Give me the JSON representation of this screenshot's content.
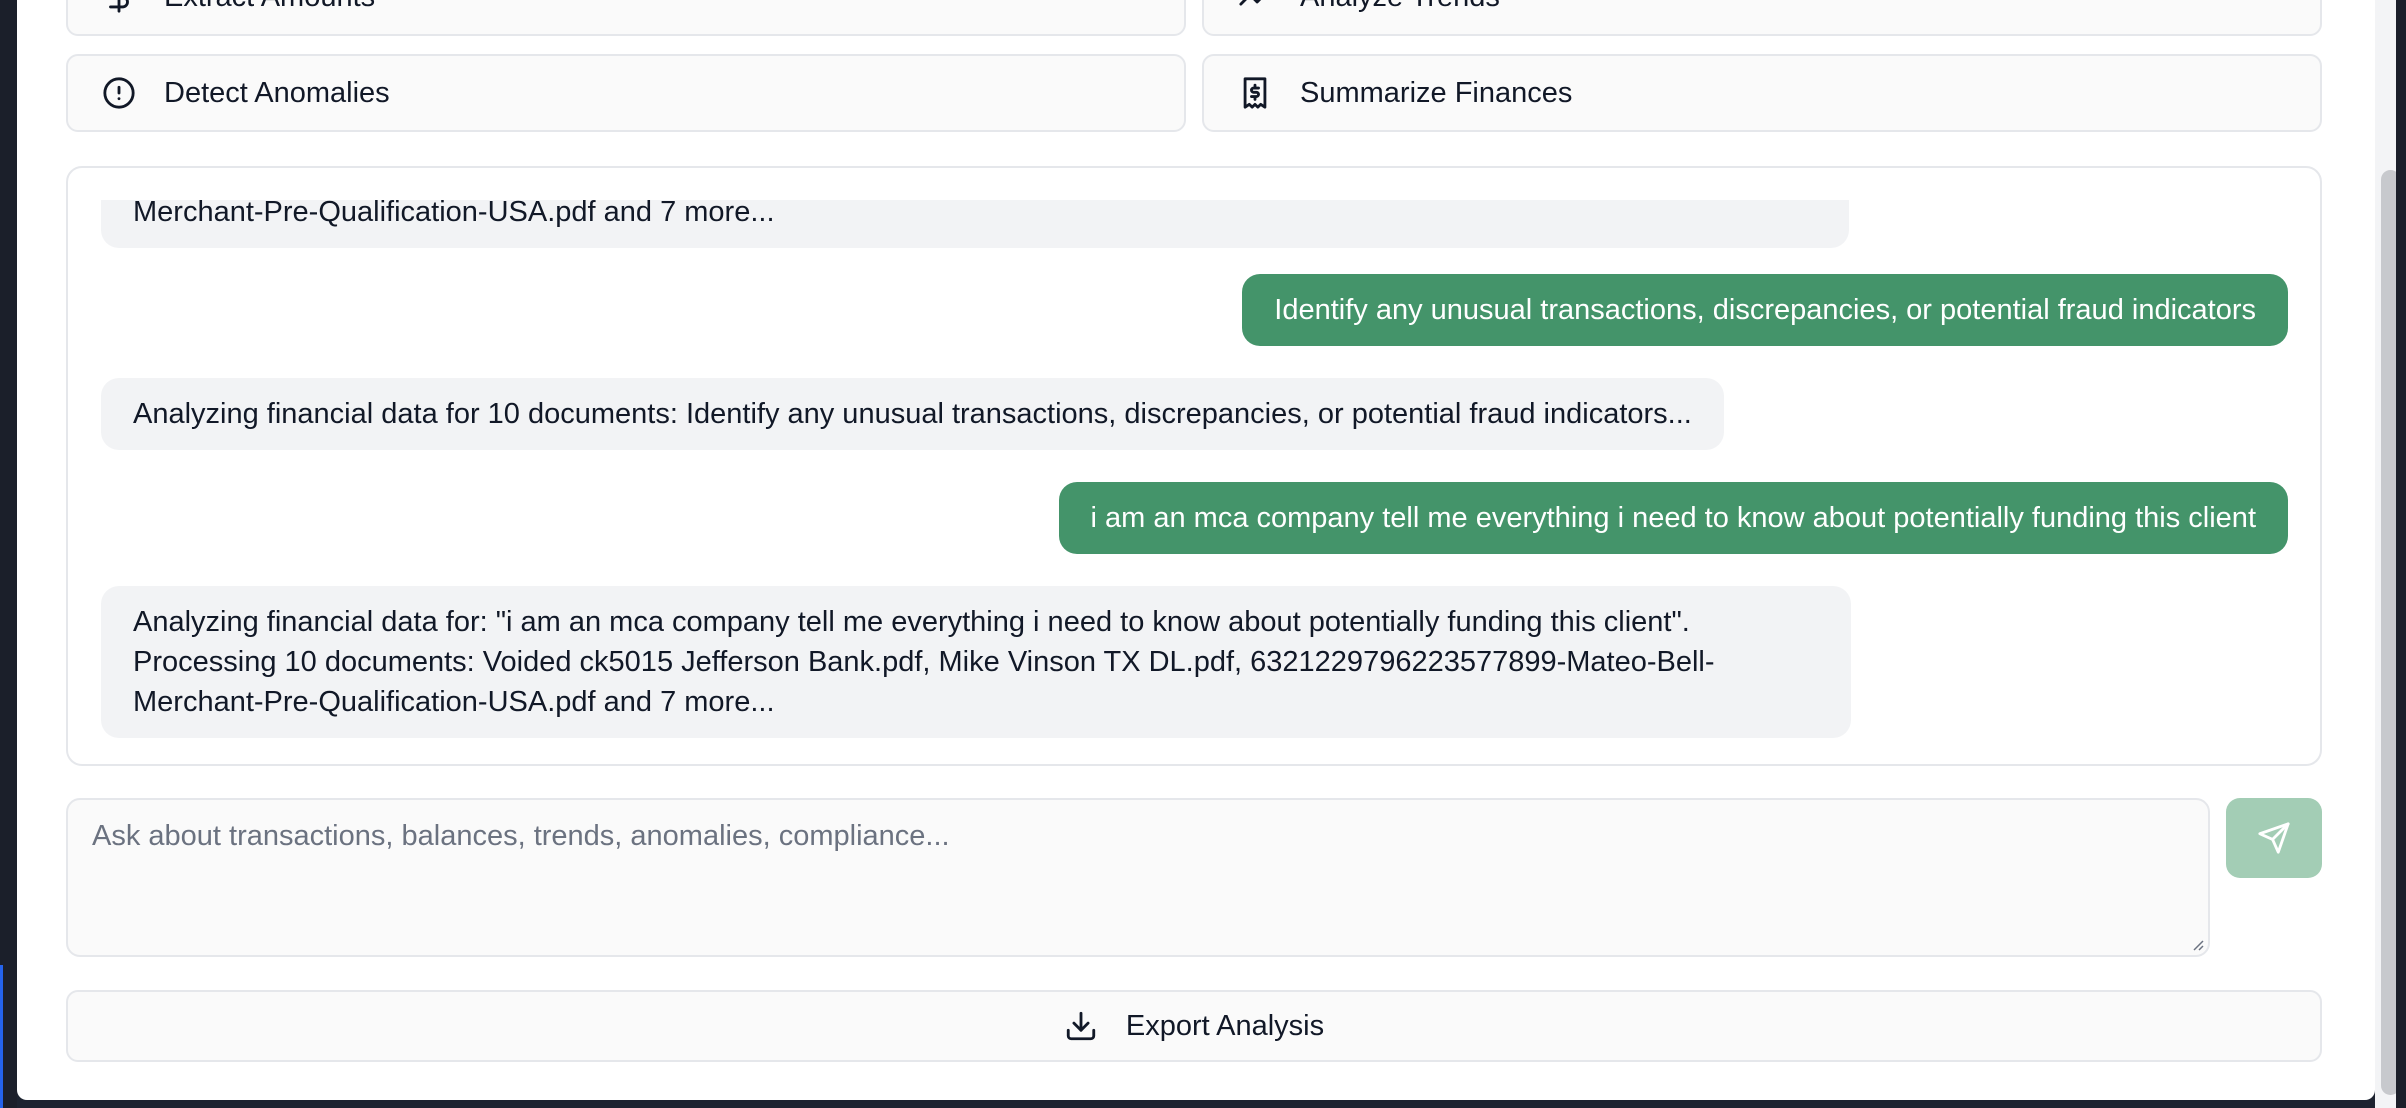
{
  "quick_actions": {
    "extract": {
      "label": "Extract Amounts",
      "icon": "dollar-icon"
    },
    "trends": {
      "label": "Analyze Trends",
      "icon": "trend-icon"
    },
    "anomalies": {
      "label": "Detect Anomalies",
      "icon": "alert-circle-icon"
    },
    "summarize": {
      "label": "Summarize Finances",
      "icon": "receipt-icon"
    }
  },
  "chat": {
    "messages": [
      {
        "role": "assistant",
        "lines": [
          "Merchant-Pre-Qualification-USA.pdf and 7 more..."
        ]
      },
      {
        "role": "user",
        "lines": [
          "Identify any unusual transactions, discrepancies, or potential fraud indicators"
        ]
      },
      {
        "role": "assistant",
        "lines": [
          "Analyzing financial data for 10 documents: Identify any unusual transactions, discrepancies, or potential fraud indicators..."
        ]
      },
      {
        "role": "user",
        "lines": [
          "i am an mca company tell me everything i need to know about potentially funding this client"
        ]
      },
      {
        "role": "assistant",
        "lines": [
          "Analyzing financial data for: \"i am an mca company tell me everything i need to know about potentially funding this client\".",
          "Processing 10 documents: Voided ck5015 Jefferson Bank.pdf, Mike Vinson TX DL.pdf, 6321229796223577899-Mateo-Bell-",
          "Merchant-Pre-Qualification-USA.pdf and 7 more..."
        ]
      }
    ]
  },
  "input": {
    "placeholder": "Ask about transactions, balances, trends, anomalies, compliance...",
    "value": ""
  },
  "send": {
    "icon": "send-icon"
  },
  "export": {
    "label": "Export Analysis",
    "icon": "download-icon"
  },
  "colors": {
    "accent": "#44946a",
    "accent_disabled": "#a3cdb5",
    "bot_bubble": "#f2f3f5"
  }
}
